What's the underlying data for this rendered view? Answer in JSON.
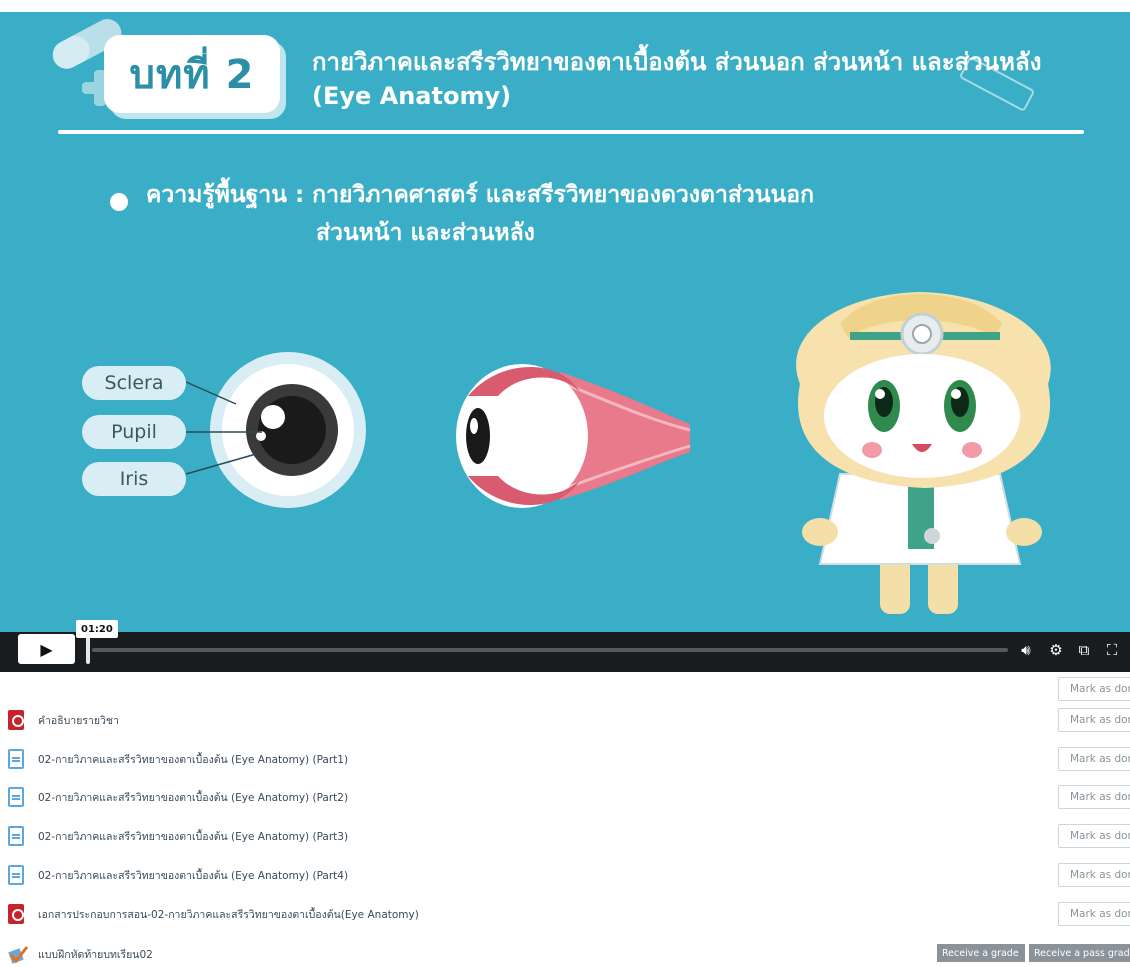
{
  "video": {
    "slide": {
      "lesson_badge": "บทที่ 2",
      "title_line1": "กายวิภาคและสรีรวิทยาของตาเบื้องต้น ส่วนนอก ส่วนหน้า และส่วนหลัง",
      "title_line2": "(Eye Anatomy)",
      "topic_line1": "ความรู้พื้นฐาน : กายวิภาคศาสตร์ และสรีรวิทยาของดวงตาส่วนนอก",
      "topic_line2": "ส่วนหน้า และส่วนหลัง",
      "eye_labels": [
        "Sclera",
        "Pupil",
        "Iris"
      ],
      "colors": {
        "background": "#3aaec7",
        "text": "#ffffff",
        "badge_text": "#2b8fa8"
      }
    },
    "player": {
      "current_time": "01:20",
      "progress": 0.0,
      "icons": [
        "play-icon",
        "volume-icon",
        "settings-icon",
        "pip-icon",
        "fullscreen-icon"
      ]
    }
  },
  "activities": {
    "mark_label": "Mark as done",
    "top_mark_label": "Mark as done",
    "items": [
      {
        "icon": "pdf-icon",
        "title": "คำอธิบายรายวิชา",
        "action": "Mark as done"
      },
      {
        "icon": "document-icon",
        "title": "02-กายวิภาคและสรีรวิทยาของตาเบื้องต้น (Eye Anatomy) (Part1)",
        "action": "Mark as done"
      },
      {
        "icon": "document-icon",
        "title": "02-กายวิภาคและสรีรวิทยาของตาเบื้องต้น (Eye Anatomy) (Part2)",
        "action": "Mark as done"
      },
      {
        "icon": "document-icon",
        "title": "02-กายวิภาคและสรีรวิทยาของตาเบื้องต้น (Eye Anatomy) (Part3)",
        "action": "Mark as done"
      },
      {
        "icon": "document-icon",
        "title": "02-กายวิภาคและสรีรวิทยาของตาเบื้องต้น (Eye Anatomy) (Part4)",
        "action": "Mark as done"
      },
      {
        "icon": "pdf-icon",
        "title": "เอกสารประกอบการสอน-02-กายวิภาคและสรีรวิทยาของตาเบื้องต้น(Eye Anatomy)",
        "action": "Mark as done"
      },
      {
        "icon": "quiz-icon",
        "title": "แบบฝึกหัดท้ายบทเรียน02"
      }
    ],
    "grade_buttons": [
      "Receive a grade",
      "Receive a pass grade"
    ]
  }
}
